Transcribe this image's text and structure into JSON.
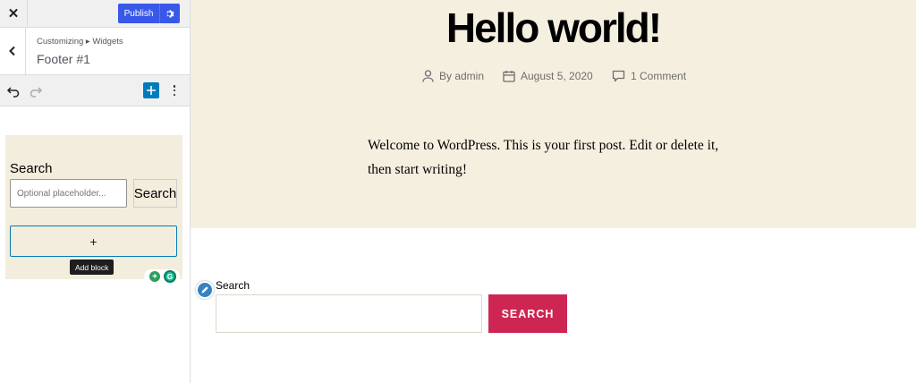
{
  "sidebar": {
    "close_glyph": "✕",
    "publish_label": "Publish",
    "breadcrumb": "Customizing ▸ Widgets",
    "section_title": "Footer #1",
    "widget": {
      "search_label": "Search",
      "search_placeholder": "Optional placeholder...",
      "search_button": "Search",
      "appender_glyph": "+",
      "tooltip": "Add block",
      "ext_plus_glyph": "+",
      "ext_g_glyph": "G"
    },
    "icons": {
      "close": "close-icon",
      "settings": "gear-icon",
      "back": "chevron-left-icon",
      "undo": "undo-icon",
      "redo": "redo-icon",
      "inserter": "plus-icon",
      "more": "more-vertical-icon"
    }
  },
  "preview": {
    "post_title": "Hello world!",
    "meta": {
      "author": "By admin",
      "date": "August 5, 2020",
      "comments": "1 Comment"
    },
    "body": "Welcome to WordPress. This is your first post. Edit or delete it, then start writing!",
    "footer_search": {
      "label": "Search",
      "value": "",
      "button": "SEARCH"
    }
  },
  "colors": {
    "accent": "#3858e9",
    "hero_bg": "#f5efe0",
    "search_button": "#cd2653",
    "widget_bg": "#f3eddd"
  }
}
